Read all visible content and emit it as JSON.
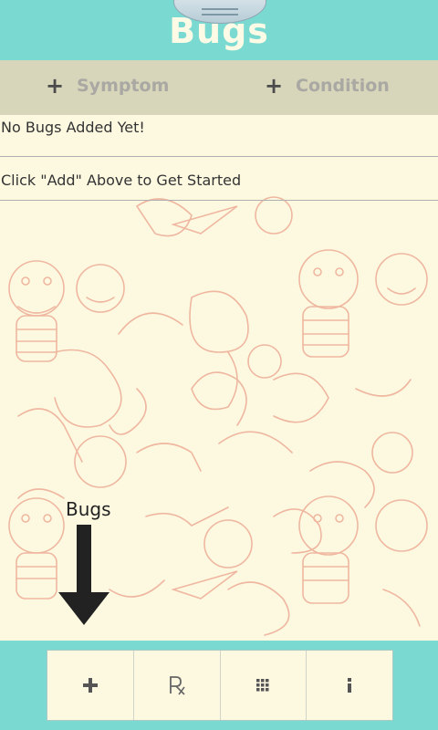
{
  "app": {
    "title": "Bugs"
  },
  "toolbar": {
    "symptom_label": "Symptom",
    "condition_label": "Condition"
  },
  "list": {
    "empty_message": "No Bugs Added Yet!",
    "hint_message": "Click \"Add\" Above to Get Started"
  },
  "hint": {
    "label": "Bugs"
  },
  "bottom_nav": {
    "items": [
      {
        "icon": "plus-icon"
      },
      {
        "icon": "rx-icon"
      },
      {
        "icon": "grid-icon"
      },
      {
        "icon": "info-icon"
      }
    ]
  },
  "colors": {
    "header": "#7ad9d1",
    "toolbar": "#d7d5ba",
    "background": "#fdf9e1",
    "pattern": "#f1b9a0"
  }
}
